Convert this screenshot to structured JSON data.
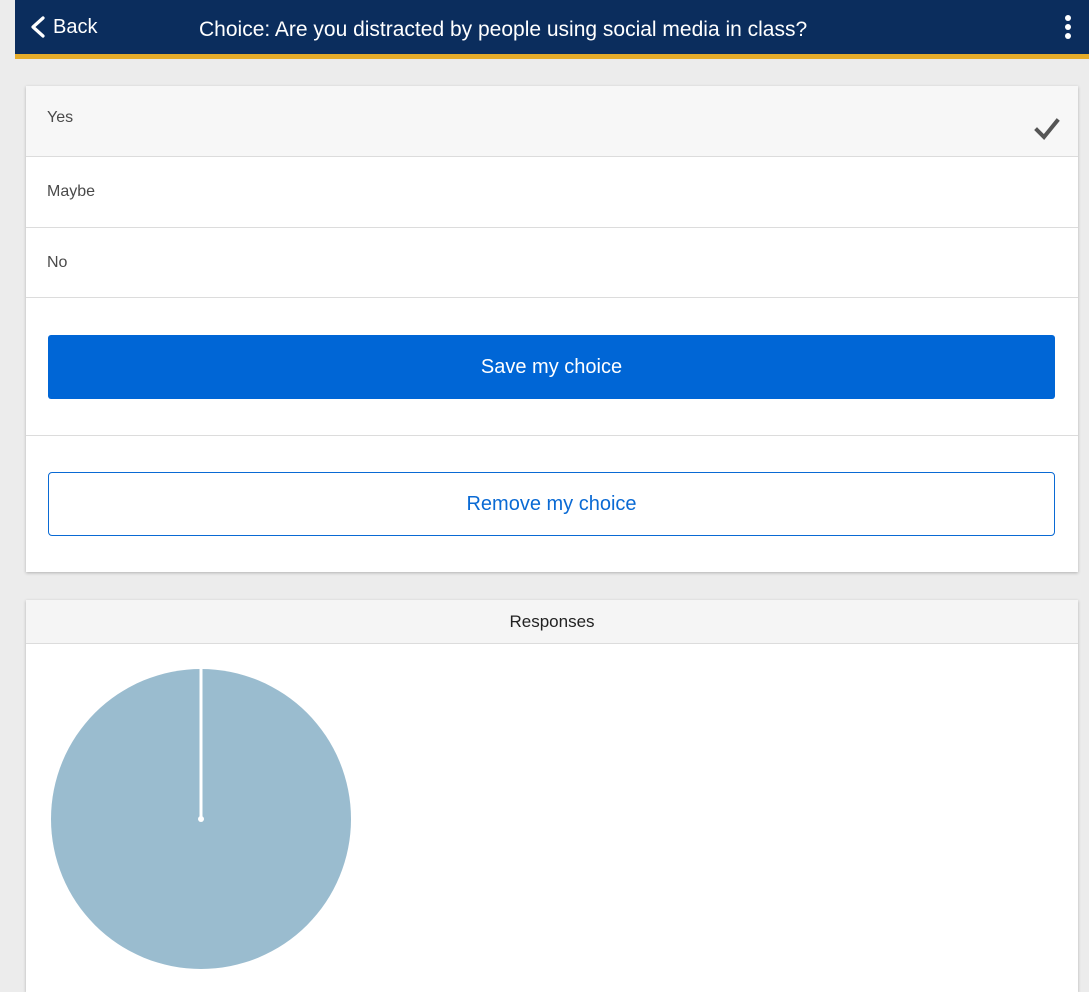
{
  "header": {
    "back_label": "Back",
    "title": "Choice: Are you distracted by people using social media in class?",
    "background_color": "#0b2d5d",
    "accent_color": "#e6ac2a"
  },
  "choice": {
    "options": [
      {
        "label": "Yes",
        "selected": true
      },
      {
        "label": "Maybe",
        "selected": false
      },
      {
        "label": "No",
        "selected": false
      }
    ],
    "save_label": "Save my choice",
    "remove_label": "Remove my choice",
    "primary_color": "#0066d6"
  },
  "responses": {
    "title": "Responses"
  },
  "chart_data": {
    "type": "pie",
    "title": "",
    "categories": [
      "Yes"
    ],
    "values": [
      1
    ],
    "colors": [
      "#9abccf"
    ]
  }
}
